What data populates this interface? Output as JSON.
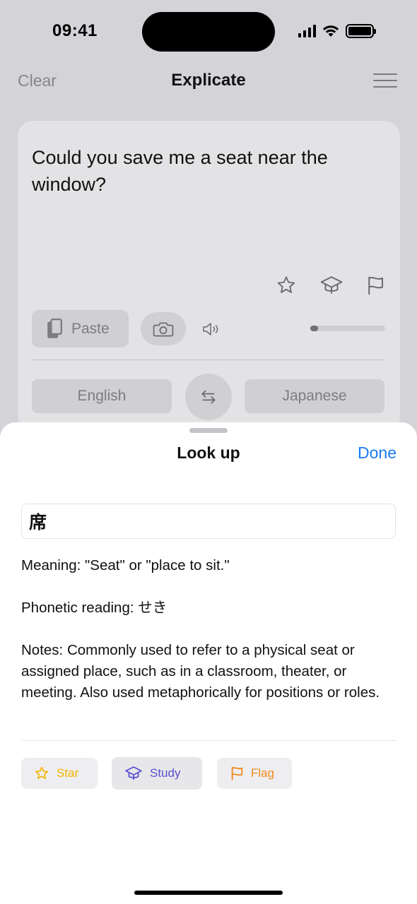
{
  "status_bar": {
    "time": "09:41"
  },
  "nav": {
    "clear_label": "Clear",
    "title": "Explicate",
    "menu_icon": "hamburger-menu-icon"
  },
  "card": {
    "source_text": "Could you save me a seat near the window?",
    "paste_label": "Paste",
    "audio_progress": 0.1,
    "source_language": "English",
    "target_language": "Japanese"
  },
  "sheet": {
    "title": "Look up",
    "done_label": "Done",
    "query": "席",
    "meaning": "Meaning: \"Seat\" or \"place to sit.\"",
    "phonetic": "Phonetic reading: せき",
    "notes": "Notes: Commonly used to refer to a physical seat or assigned place, such as in a classroom, theater, or meeting. Also used metaphorically for positions or roles.",
    "chips": {
      "star": "Star",
      "study": "Study",
      "flag": "Flag"
    }
  },
  "colors": {
    "accent": "#1a7cf5",
    "star": "#f3b400",
    "study": "#5b4fd0",
    "flag": "#f08a1c"
  }
}
